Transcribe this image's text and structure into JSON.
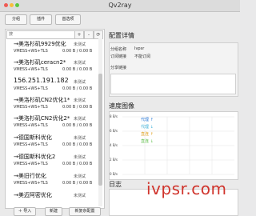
{
  "window": {
    "title": "Qv2ray"
  },
  "toolbar": {
    "groups": "分组",
    "plugins": "插件",
    "preferences": "首选项"
  },
  "search": {
    "value": "搜"
  },
  "icons": {
    "add": "+",
    "remove": "-",
    "refresh": "⟳"
  },
  "servers": [
    {
      "name": "→美洛杉矶9929优化",
      "status": "未测试",
      "meta": "VMESS+WS+TLS",
      "traffic": "0.00 B / 0.00 B"
    },
    {
      "name": "→美洛杉矶ceracn2*",
      "status": "未测试",
      "meta": "VMESS+WS+TLS",
      "traffic": "0.00 B / 0.00 B"
    },
    {
      "name": "156.251.191.182",
      "status": "未测试",
      "meta": "VMESS+WS+TLS",
      "traffic": "0.00 B / 0.00 B"
    },
    {
      "name": "→美洛杉矶CN2优化1*",
      "status": "未测试",
      "meta": "VMESS+WS+TLS",
      "traffic": "0.00 B / 0.00 B"
    },
    {
      "name": "→美洛杉矶CN2优化2*",
      "status": "未测试",
      "meta": "VMESS+WS+TLS",
      "traffic": "0.00 B / 0.00 B"
    },
    {
      "name": "→德国斯科优化",
      "status": "未测试",
      "meta": "VMESS+WS+TLS",
      "traffic": "0.00 B / 0.00 B"
    },
    {
      "name": "→德国斯科优化2",
      "status": "未测试",
      "meta": "VMESS+WS+TLS",
      "traffic": "0.00 B / 0.00 B"
    },
    {
      "name": "→美旧行优化",
      "status": "未测试",
      "meta": "VMESS+WS+TLS",
      "traffic": "0.00 B / 0.00 B"
    },
    {
      "name": "→美迈阿密优化",
      "status": "未测试",
      "meta": "",
      "traffic": ""
    }
  ],
  "bottom": {
    "import": "导入",
    "new": "新建",
    "new_complex": "新复杂配置"
  },
  "config": {
    "title": "配置详情",
    "group_label": "分组名称",
    "group_value": "Ivpsr",
    "status_label": "订阅链接",
    "status_value": "不能订阅",
    "share_label": "分享链接"
  },
  "speed": {
    "title": "速度图像",
    "yticks": [
      "8 B/s",
      "6 B/s",
      "4 B/s",
      "2 B/s",
      "0 B/s"
    ],
    "legend": [
      {
        "name": "代理 ↑",
        "color": "#2a7ad8"
      },
      {
        "name": "代理 ↓",
        "color": "#3cb0d8"
      },
      {
        "name": "直连 ↑",
        "color": "#e0a020"
      },
      {
        "name": "直连 ↓",
        "color": "#5fbf4a"
      }
    ]
  },
  "log": {
    "title": "日志"
  },
  "watermark": "ivpsr.com"
}
